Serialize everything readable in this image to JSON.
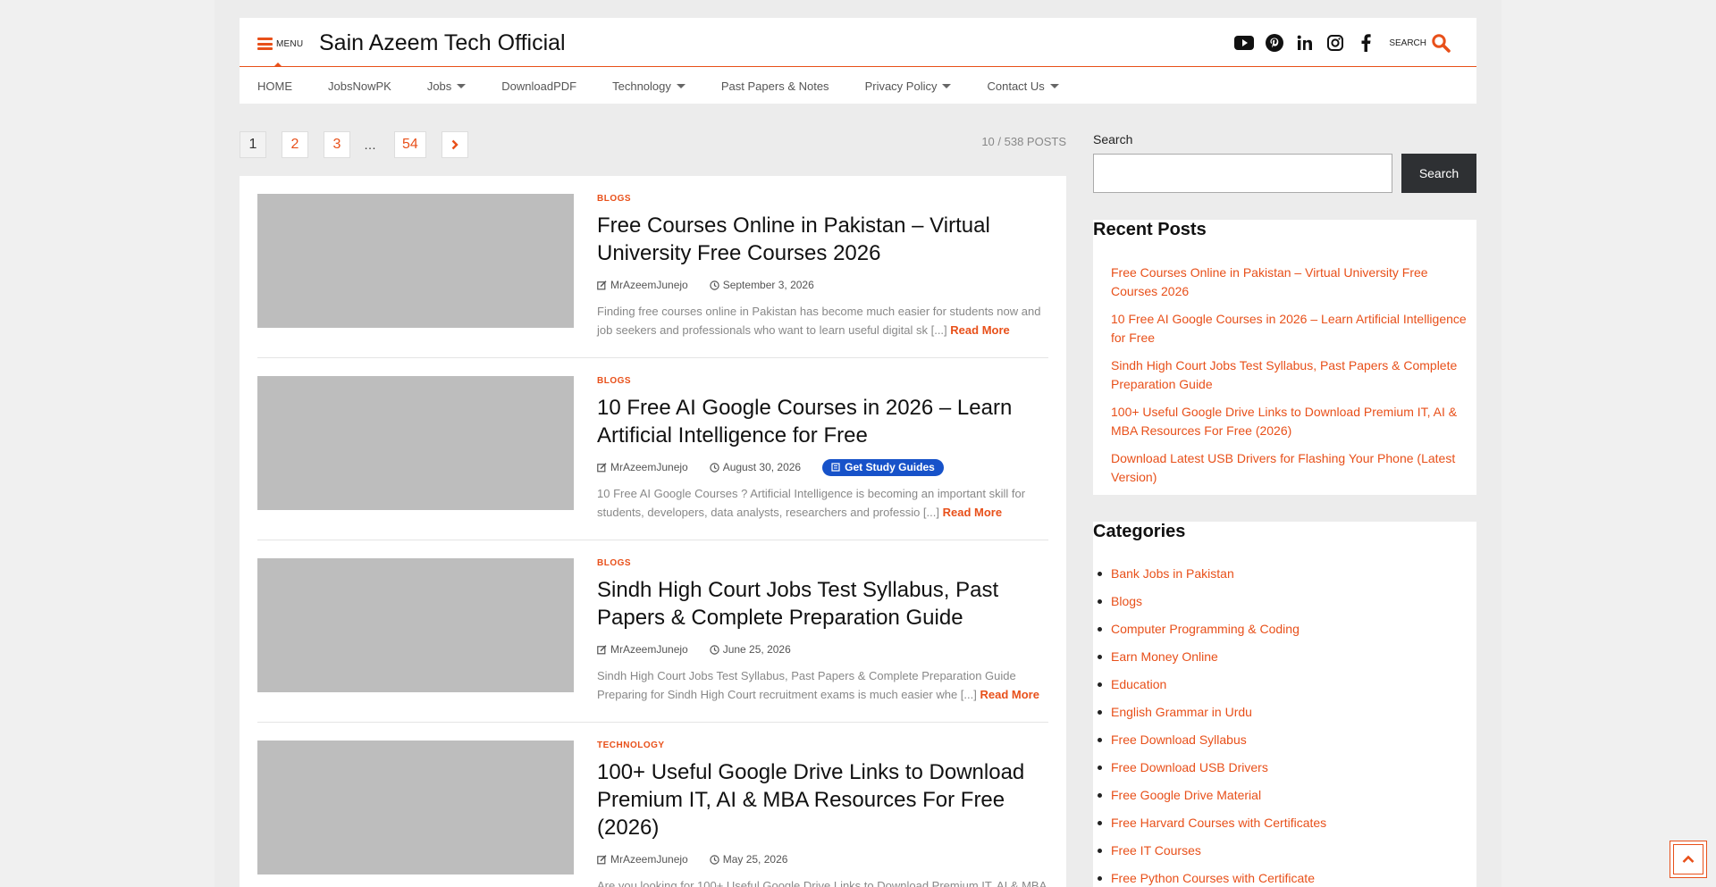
{
  "header": {
    "menu_label": "MENU",
    "site_title": "Sain Azeem Tech Official",
    "search_label": "SEARCH",
    "socials": [
      "youtube-icon",
      "pinterest-icon",
      "linkedin-icon",
      "instagram-icon",
      "facebook-icon"
    ]
  },
  "nav": {
    "items": [
      {
        "label": "HOME",
        "dropdown": false
      },
      {
        "label": "JobsNowPK",
        "dropdown": false
      },
      {
        "label": "Jobs",
        "dropdown": true
      },
      {
        "label": "DownloadPDF",
        "dropdown": false
      },
      {
        "label": "Technology",
        "dropdown": true
      },
      {
        "label": "Past Papers & Notes",
        "dropdown": false
      },
      {
        "label": "Privacy Policy",
        "dropdown": true
      },
      {
        "label": "Contact Us",
        "dropdown": true
      }
    ]
  },
  "pagination": {
    "pages": [
      "1",
      "2",
      "3"
    ],
    "dots": "…",
    "last": "54",
    "count": "10 / 538 POSTS"
  },
  "posts": [
    {
      "category": "BLOGS",
      "title": "Free Courses Online in Pakistan – Virtual University Free Courses 2026",
      "author": "MrAzeemJunejo",
      "date": "September 3, 2026",
      "excerpt": "Finding free courses online in Pakistan has become much easier for students now and job seekers and professionals who want to learn useful digital sk [...]",
      "read_more": "Read More"
    },
    {
      "category": "BLOGS",
      "title": "10 Free AI Google Courses in 2026 – Learn Artificial Intelligence for Free",
      "author": "MrAzeemJunejo",
      "date": "August 30, 2026",
      "badge": "Get Study Guides",
      "excerpt": "10 Free AI Google Courses ? Artificial Intelligence is becoming an important skill for students, developers, data analysts, researchers and professio [...]",
      "read_more": "Read More"
    },
    {
      "category": "BLOGS",
      "title": "Sindh High Court Jobs Test Syllabus, Past Papers & Complete Preparation Guide",
      "author": "MrAzeemJunejo",
      "date": "June 25, 2026",
      "excerpt": "Sindh High Court Jobs Test Syllabus, Past Papers & Complete Preparation Guide Preparing for Sindh High Court recruitment exams is much easier whe [...]",
      "read_more": "Read More"
    },
    {
      "category": "TECHNOLOGY",
      "title": "100+ Useful Google Drive Links to Download Premium IT, AI & MBA Resources For Free (2026)",
      "author": "MrAzeemJunejo",
      "date": "May 25, 2026",
      "excerpt": "Are you looking for 100+ Useful Google Drive Links to Download Premium IT, AI & MBA",
      "read_more": ""
    }
  ],
  "sidebar": {
    "search_label": "Search",
    "search_button": "Search",
    "search_value": "",
    "recent_title": "Recent Posts",
    "recent": [
      "Free Courses Online in Pakistan – Virtual University Free Courses 2026",
      "10 Free AI Google Courses in 2026 – Learn Artificial Intelligence for Free",
      "Sindh High Court Jobs Test Syllabus, Past Papers & Complete Preparation Guide",
      "100+ Useful Google Drive Links to Download Premium IT, AI & MBA Resources For Free (2026)",
      "Download Latest USB Drivers for Flashing Your Phone (Latest Version)"
    ],
    "categories_title": "Categories",
    "categories": [
      "Bank Jobs in Pakistan",
      "Blogs",
      "Computer Programming & Coding",
      "Earn Money Online",
      "Education",
      "English Grammar in Urdu",
      "Free Download Syllabus",
      "Free Download USB Drivers",
      "Free Google Drive Material",
      "Free Harvard Courses with Certificates",
      "Free IT Courses",
      "Free Python Courses with Certificate"
    ]
  },
  "colors": {
    "accent": "#e8501a",
    "badge": "#1752c9",
    "search_button": "#2e3033"
  }
}
